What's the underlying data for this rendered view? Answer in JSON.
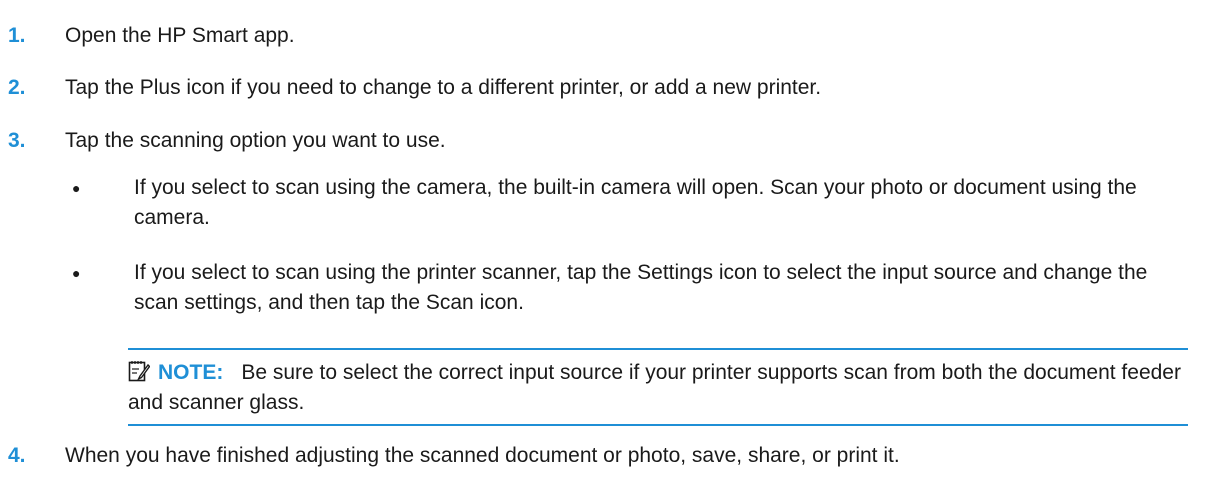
{
  "steps": [
    {
      "number": "1.",
      "text": "Open the HP Smart app."
    },
    {
      "number": "2.",
      "text": "Tap the Plus icon if you need to change to a different printer, or add a new printer."
    },
    {
      "number": "3.",
      "text": "Tap the scanning option you want to use."
    },
    {
      "number": "4.",
      "text": "When you have finished adjusting the scanned document or photo, save, share, or print it."
    }
  ],
  "bullets": [
    {
      "symbol": "●",
      "text": "If you select to scan using the camera, the built-in camera will open. Scan your photo or document using the camera."
    },
    {
      "symbol": "●",
      "text": "If you select to scan using the printer scanner, tap the Settings icon to select the input source and change the scan settings, and then tap the Scan icon."
    }
  ],
  "note": {
    "icon": "note-pencil-icon",
    "label": "NOTE:",
    "text": "Be sure to select the correct input source if your printer supports scan from both the document feeder and scanner glass."
  },
  "colors": {
    "accent": "#1f8fd6",
    "text": "#1a1a1a"
  }
}
